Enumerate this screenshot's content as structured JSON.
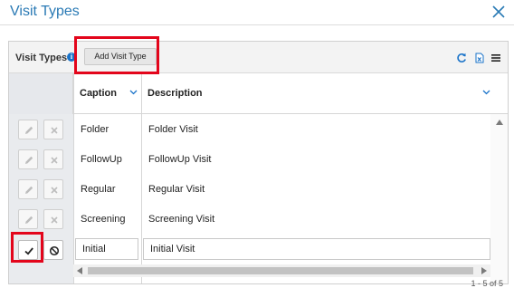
{
  "dialog": {
    "title": "Visit Types",
    "close_icon": "close-icon"
  },
  "toolbar": {
    "label": "Visit Types",
    "info_glyph": "i",
    "add_button": "Add Visit Type",
    "icons": [
      "refresh-icon",
      "export-excel-icon",
      "menu-icon"
    ]
  },
  "grid": {
    "columns": [
      {
        "label": "Caption"
      },
      {
        "label": "Description"
      }
    ],
    "rows": [
      {
        "caption": "Folder",
        "description": "Folder Visit"
      },
      {
        "caption": "FollowUp",
        "description": "FollowUp Visit"
      },
      {
        "caption": "Regular",
        "description": "Regular Visit"
      },
      {
        "caption": "Screening",
        "description": "Screening Visit"
      }
    ],
    "edit_row": {
      "caption": "Initial",
      "description": "Initial Visit"
    }
  },
  "footer": {
    "fragment": "1 - 5 of 5"
  },
  "colors": {
    "accent": "#2a7ab5",
    "highlight": "#e3051b",
    "link_blue": "#1a73c9"
  }
}
